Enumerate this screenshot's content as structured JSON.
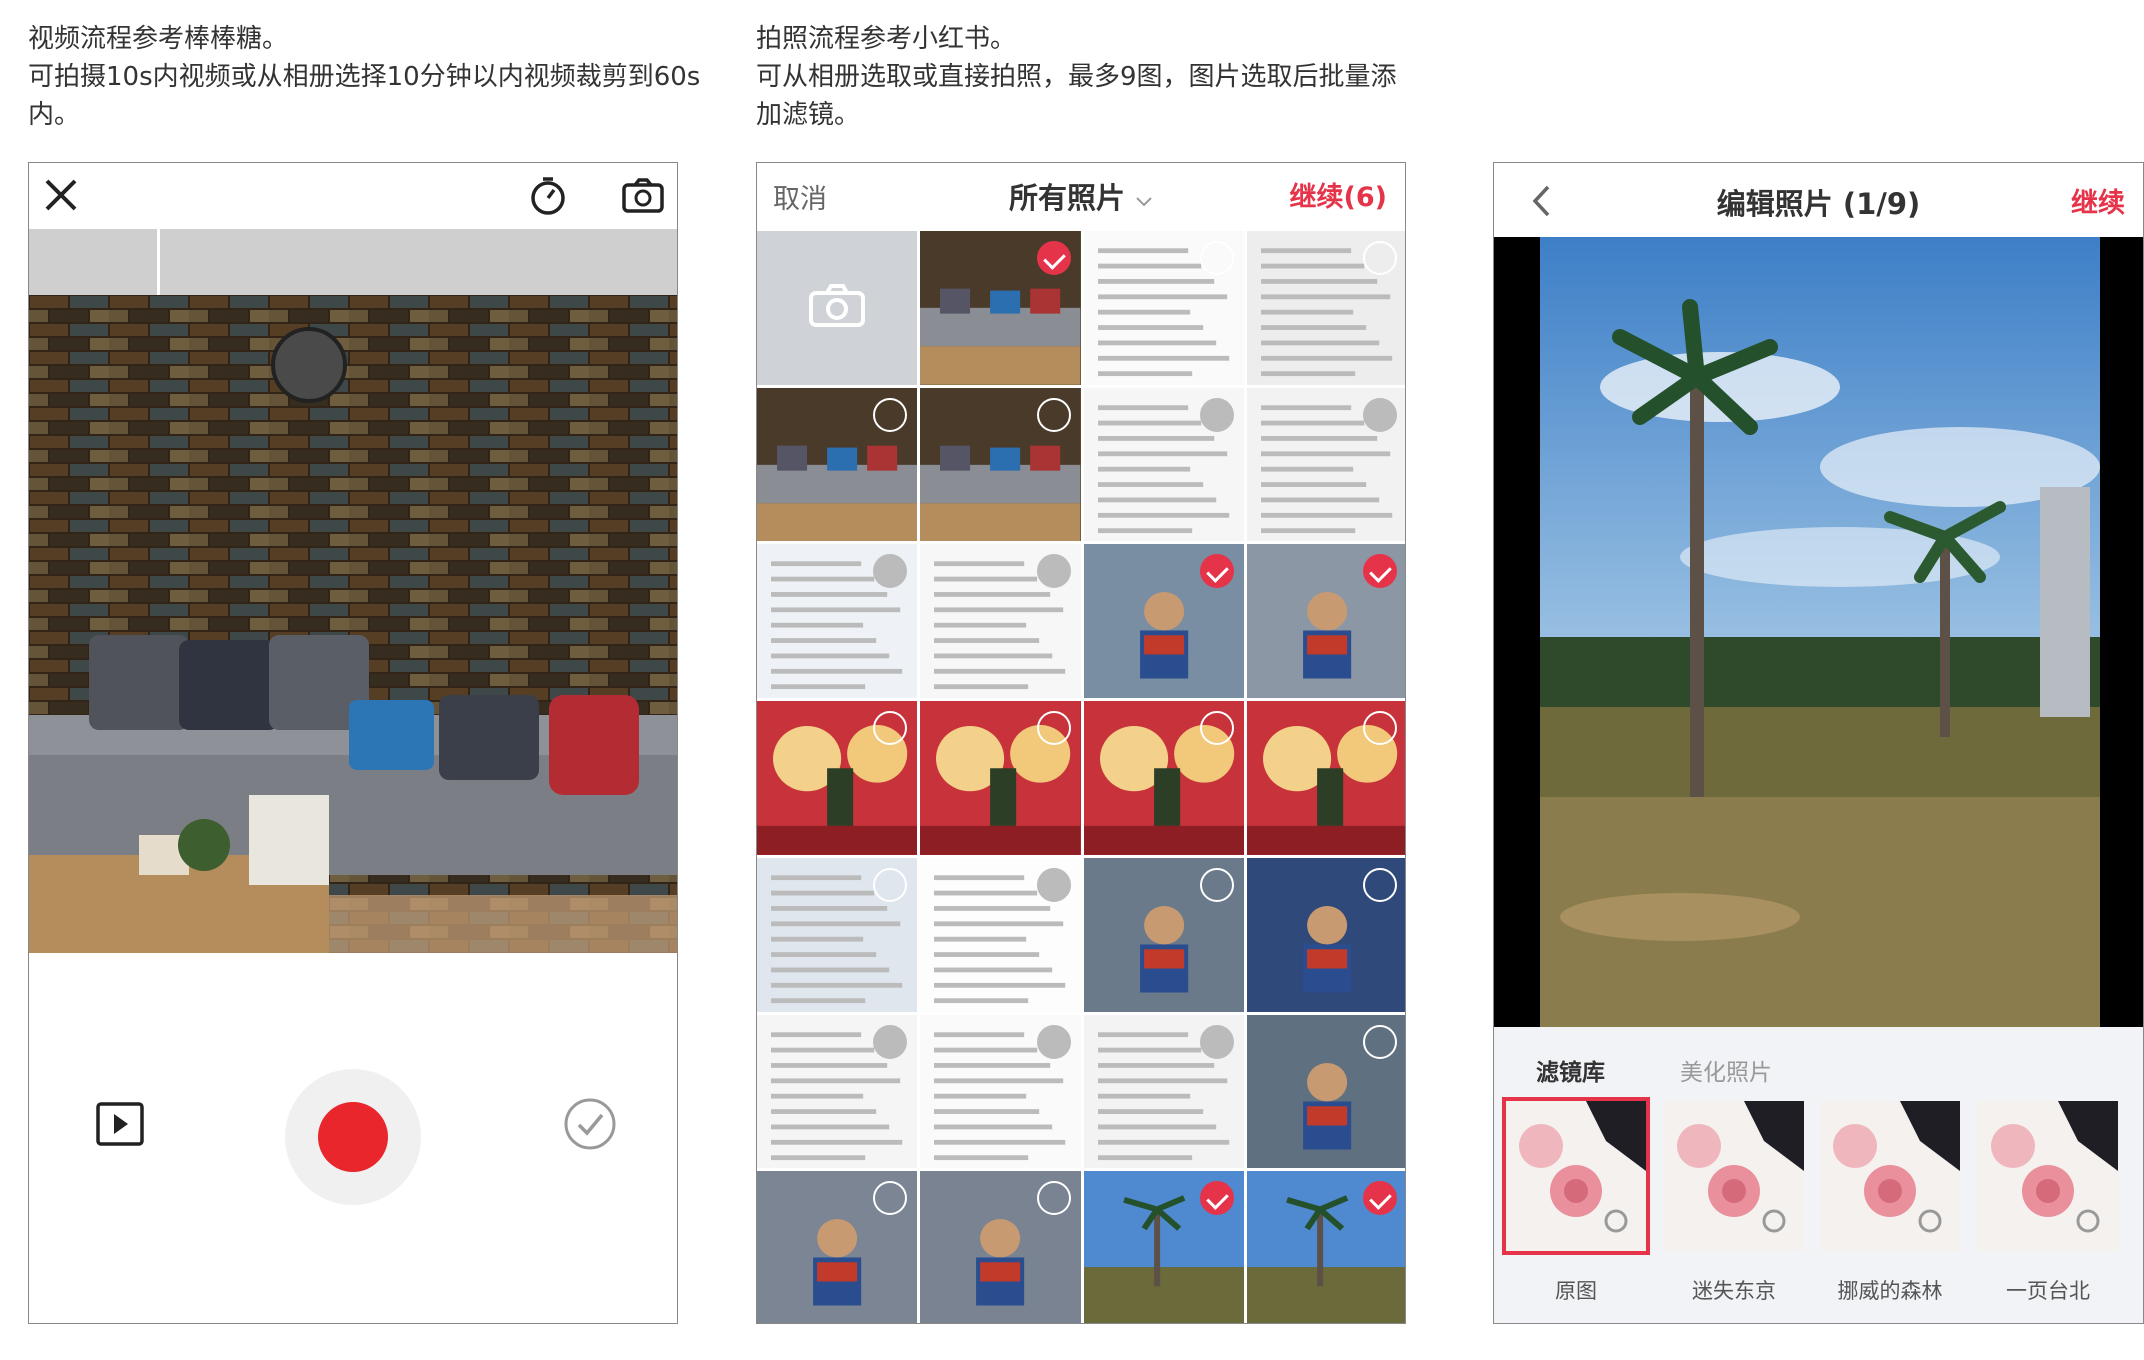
{
  "notes": {
    "video": [
      "视频流程参考棒棒糖。",
      "可拍摄10s内视频或从相册选择10分钟以内视频裁剪到60s",
      "内。"
    ],
    "photo": [
      "拍照流程参考小红书。",
      "可从相册选取或直接拍照，最多9图，图片选取后批量添",
      "加滤镜。"
    ]
  },
  "video_screen": {
    "icons": [
      "close-icon",
      "timer-icon",
      "camera-flip-icon",
      "play-video-icon",
      "record-icon",
      "check-icon"
    ],
    "record_color": "#e8262b"
  },
  "picker_screen": {
    "cancel": "取消",
    "title": "所有照片",
    "continue": "继续(6)",
    "accent": "#e5344a"
  },
  "edit_screen": {
    "title": "编辑照片 (1/9)",
    "continue": "继续",
    "tabs": [
      "滤镜库",
      "美化照片"
    ],
    "filters": [
      "原图",
      "迷失东京",
      "挪威的森林",
      "一页台北"
    ]
  }
}
